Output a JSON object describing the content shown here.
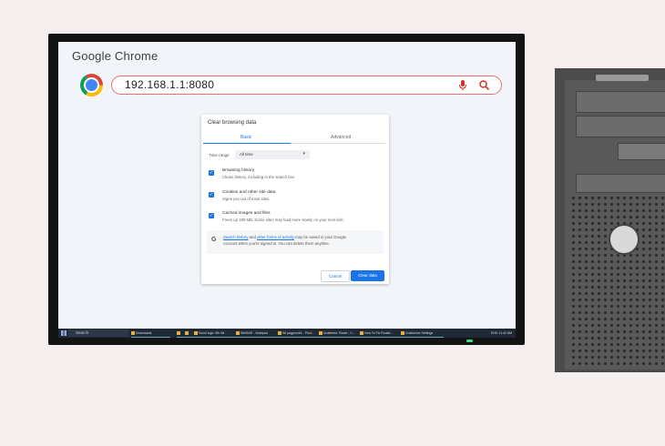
{
  "app": {
    "title": "Google Chrome"
  },
  "omnibox": {
    "value": "192.168.1.1:8080",
    "mic_icon": "mic-icon",
    "search_icon": "search-icon"
  },
  "dialog": {
    "title": "Clear browsing data",
    "tabs": [
      {
        "label": "Basic",
        "active": true
      },
      {
        "label": "Advanced",
        "active": false
      }
    ],
    "time_range": {
      "label": "Time range",
      "value": "All time"
    },
    "options": [
      {
        "title": "Browsing history",
        "desc": "Clears history, including in the search box",
        "checked": true
      },
      {
        "title": "Cookies and other site data",
        "desc": "Signs you out of most sites.",
        "checked": true
      },
      {
        "title": "Cached images and files",
        "desc": "Frees up 180 MB. Some sites may load more slowly on your next visit.",
        "checked": true
      }
    ],
    "google_note": {
      "link1": "Search history",
      "and": " and ",
      "link2": "other forms of activity",
      "rest1": " may be saved in your Google",
      "line2": "Account when you're signed in. You can delete them anytime."
    },
    "cancel_label": "Cancel",
    "clear_label": "Clear data"
  },
  "taskbar": {
    "search_placeholder": "Search",
    "items": [
      "Downloads",
      "",
      "",
      "Scroll logo: 9th Wi...",
      "WinRAR - Notepad",
      "Wi pagproc64 - Phot...",
      "Unaltered: Reset - C...",
      "How To Fix Router...",
      "Customize Settings"
    ],
    "tray": "ENG  11:42 AM"
  },
  "colors": {
    "accent": "#1a73e8",
    "omnibox_border": "#e57373"
  }
}
